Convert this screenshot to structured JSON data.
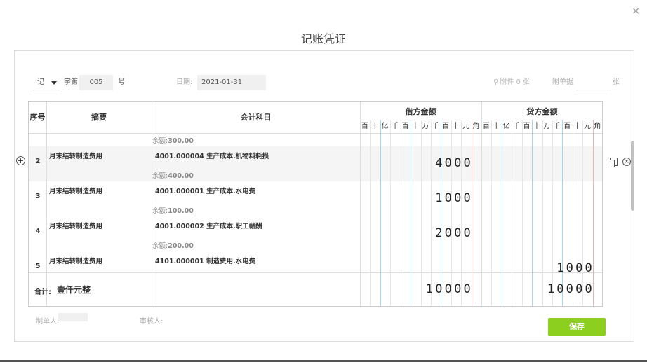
{
  "dialog": {
    "title": "记账凭证",
    "close": "×"
  },
  "toolbar": {
    "voucher_word": "记",
    "lbl_zi": "字第",
    "voucher_no": "005",
    "lbl_hao": "号",
    "date_label": "日期:",
    "date_value": "2021-01-31",
    "attach_label": "附件 0 张",
    "danju_label": "附单据",
    "danju_value": "",
    "zhang_label": "张"
  },
  "grid": {
    "headers": {
      "seq": "序号",
      "summary": "摘要",
      "account": "会计科目",
      "debit": "借方金额",
      "credit": "贷方金额"
    },
    "digit_units": [
      "百",
      "十",
      "亿",
      "千",
      "百",
      "十",
      "万",
      "千",
      "百",
      "十",
      "元",
      "角"
    ],
    "top_balance": "余额:",
    "top_balance_value": "300.00",
    "rows": [
      {
        "seq": "2",
        "summary": "月末结转制造费用",
        "account": "4001.000004 生产成本.机物料耗损",
        "balance_label": "余额:",
        "balance_value": "400.00",
        "debit": "4000",
        "credit": ""
      },
      {
        "seq": "3",
        "summary": "月末结转制造费用",
        "account": "4001.000001 生产成本.水电费",
        "balance_label": "余额:",
        "balance_value": "100.00",
        "debit": "1000",
        "credit": ""
      },
      {
        "seq": "4",
        "summary": "月末结转制造费用",
        "account": "4001.000002 生产成本.职工薪酬",
        "balance_label": "余额:",
        "balance_value": "200.00",
        "debit": "2000",
        "credit": ""
      },
      {
        "seq": "5",
        "summary": "月末结转制造费用",
        "account": "4101.000001 制造费用.水电费",
        "balance_label": "",
        "balance_value": "",
        "debit": "",
        "credit": "1000"
      }
    ],
    "total": {
      "label": "合计:",
      "text": "壹仟元整",
      "debit": "10000",
      "credit": "10000"
    }
  },
  "footer": {
    "maker_label": "制单人:",
    "reviewer_label": "审核人:",
    "save_label": "保存"
  },
  "icons": {
    "add_row": "+",
    "delete_row": "×"
  }
}
